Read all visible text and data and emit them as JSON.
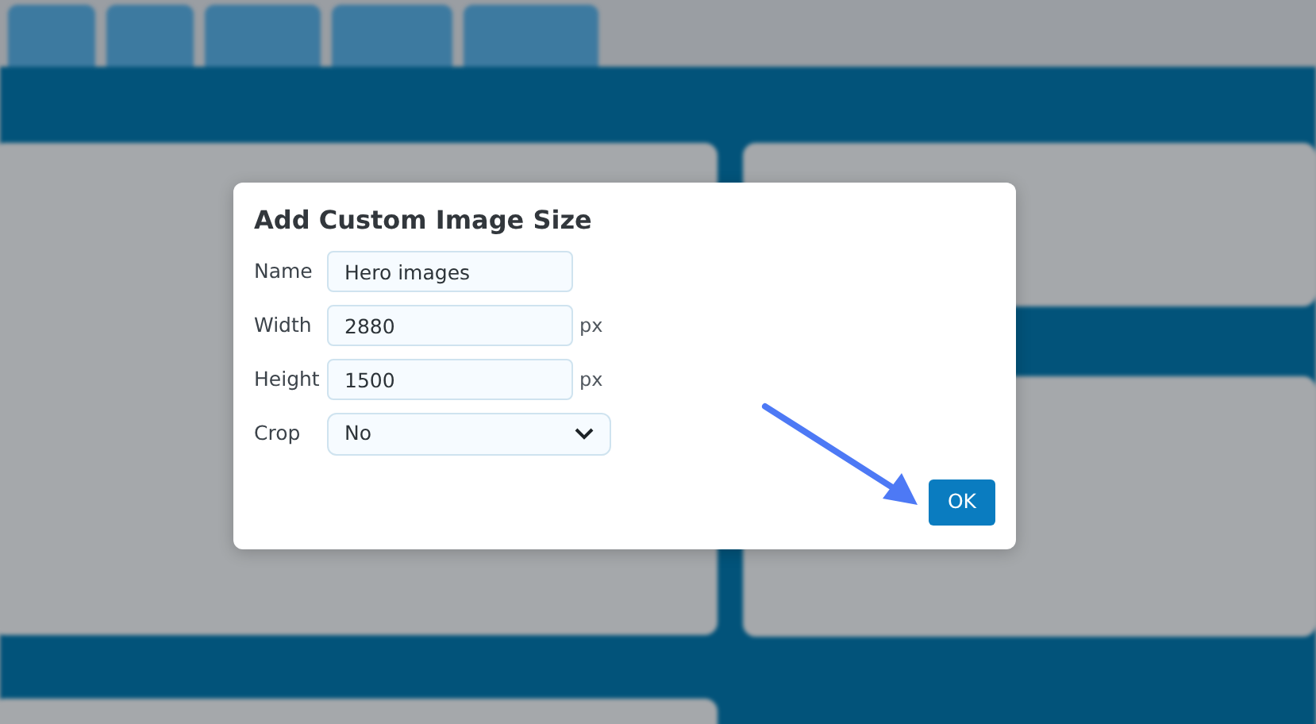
{
  "dialog": {
    "title": "Add Custom Image Size",
    "fields": [
      {
        "kind": "text",
        "label": "Name",
        "value": "Hero images"
      },
      {
        "kind": "text",
        "label": "Width",
        "value": "2880",
        "unit": "px"
      },
      {
        "kind": "text",
        "label": "Height",
        "value": "1500",
        "unit": "px"
      },
      {
        "kind": "select",
        "label": "Crop",
        "value": "No"
      }
    ],
    "buttons": [
      "OK"
    ]
  }
}
